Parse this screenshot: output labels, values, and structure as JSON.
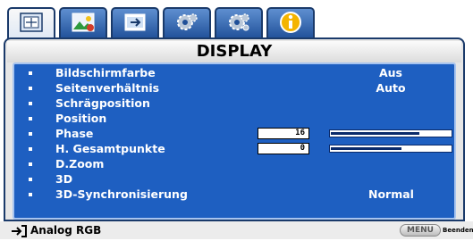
{
  "tabs": [
    {
      "icon": "picture-icon",
      "active": true
    },
    {
      "icon": "landscape-image-icon",
      "active": false
    },
    {
      "icon": "source-input-icon",
      "active": false
    },
    {
      "icon": "gear-settings-icon",
      "active": false
    },
    {
      "icon": "gear-advanced-settings-icon",
      "active": false
    },
    {
      "icon": "info-icon",
      "active": false
    }
  ],
  "menu_title": "DISPLAY",
  "rows": [
    {
      "label": "Bildschirmfarbe",
      "value": "Aus"
    },
    {
      "label": "Seitenverhältnis",
      "value": "Auto"
    },
    {
      "label": "Schrägposition",
      "value": ""
    },
    {
      "label": "Position",
      "value": ""
    },
    {
      "label": "Phase",
      "number": "16",
      "level": 0.73
    },
    {
      "label": "H. Gesamtpunkte",
      "number": "0",
      "level": 0.58
    },
    {
      "label": "D.Zoom",
      "value": ""
    },
    {
      "label": "3D",
      "value": ""
    },
    {
      "label": "3D-Synchronisierung",
      "value": "Normal"
    }
  ],
  "status": {
    "source": "Analog RGB",
    "menu_button": "MENU",
    "exit_label": "Beenden"
  },
  "colors": {
    "panel": "#1e5fc1",
    "tab": "#2f63b1",
    "frame": "#1a3a6a"
  }
}
